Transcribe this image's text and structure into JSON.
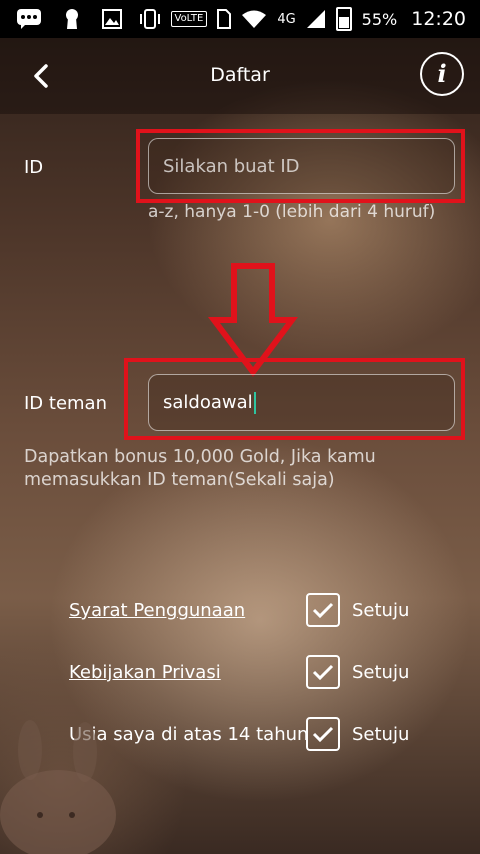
{
  "status_bar": {
    "network": "4G",
    "volte": "VoLTE",
    "battery": "55%",
    "time": "12:20"
  },
  "header": {
    "title": "Daftar",
    "back_icon": "chevron-left-icon",
    "info_icon": "info-icon",
    "info_glyph": "i"
  },
  "form": {
    "id_label": "ID",
    "id_placeholder": "Silakan buat ID",
    "id_hint": "a-z, hanya 1-0 (lebih dari 4 huruf)",
    "friend_label": "ID teman",
    "friend_value": "saldoawal",
    "friend_hint_line1": "Dapatkan bonus 10,000 Gold, Jika kamu",
    "friend_hint_line2": "memasukkan ID teman(Sekali saja)"
  },
  "agreements": [
    {
      "label": "Syarat Penggunaan",
      "agree": "Setuju",
      "checked": true
    },
    {
      "label": "Kebijakan Privasi",
      "agree": "Setuju",
      "checked": true
    },
    {
      "label": "Usia saya di atas 14 tahun",
      "agree": "Setuju",
      "checked": true
    }
  ],
  "annotation": {
    "color": "#e0121b",
    "arrow_icon": "down-arrow-icon"
  }
}
